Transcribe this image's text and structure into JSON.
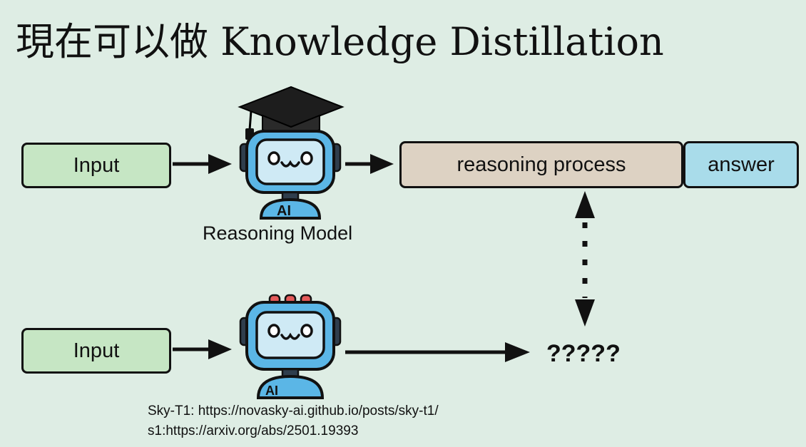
{
  "title": "現在可以做 Knowledge Distillation",
  "top_row": {
    "input_label": "Input",
    "model_label": "Reasoning Model",
    "reasoning_label": "reasoning process",
    "answer_label": "answer",
    "badge_text": "AI"
  },
  "bottom_row": {
    "input_label": "Input",
    "output_label": "?????",
    "badge_text": "AI"
  },
  "references": [
    "Sky-T1: https://novasky-ai.github.io/posts/sky-t1/",
    "s1:https://arxiv.org/abs/2501.19393"
  ],
  "colors": {
    "background": "#deede4",
    "input_box": "#c6e6c4",
    "reasoning_box": "#ddd2c3",
    "answer_box": "#a9dcea",
    "robot_body": "#5bb6e6"
  }
}
